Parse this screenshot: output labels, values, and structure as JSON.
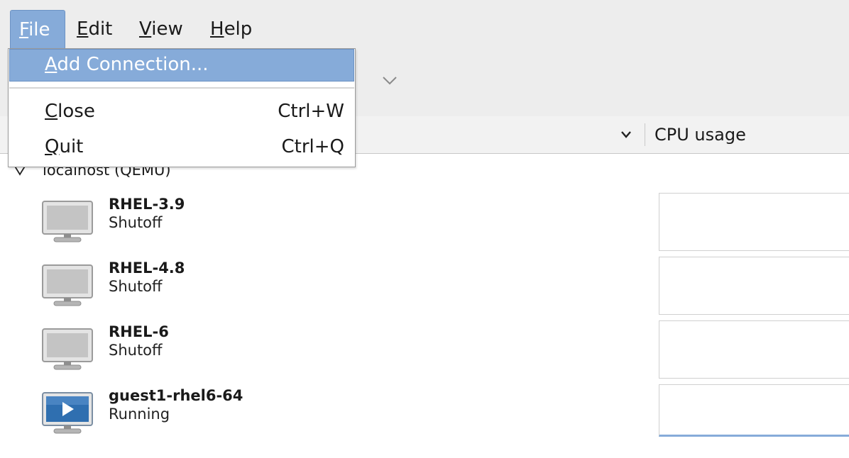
{
  "menubar": {
    "file": {
      "mnemonic": "F",
      "rest": "ile"
    },
    "edit": {
      "mnemonic": "E",
      "rest": "dit"
    },
    "view": {
      "mnemonic": "V",
      "rest": "iew"
    },
    "help": {
      "mnemonic": "H",
      "rest": "elp"
    }
  },
  "file_menu": {
    "add_connection": {
      "mnemonic": "A",
      "rest": "dd Connection..."
    },
    "close": {
      "mnemonic": "C",
      "rest": "lose",
      "accel": "Ctrl+W"
    },
    "quit": {
      "mnemonic": "Q",
      "rest": "uit",
      "accel": "Ctrl+Q"
    }
  },
  "columns": {
    "cpu_usage": "CPU usage"
  },
  "host": {
    "label": "localhost (QEMU)"
  },
  "vms": [
    {
      "name": "RHEL-3.9",
      "status": "Shutoff",
      "icon": "vm-shutoff-icon"
    },
    {
      "name": "RHEL-4.8",
      "status": "Shutoff",
      "icon": "vm-shutoff-icon"
    },
    {
      "name": "RHEL-6",
      "status": "Shutoff",
      "icon": "vm-shutoff-icon"
    },
    {
      "name": "guest1-rhel6-64",
      "status": "Running",
      "icon": "vm-running-icon"
    }
  ],
  "colors": {
    "highlight": "#86abd9",
    "menubar_bg": "#ededed",
    "running_screen": "#2f6fb0"
  }
}
